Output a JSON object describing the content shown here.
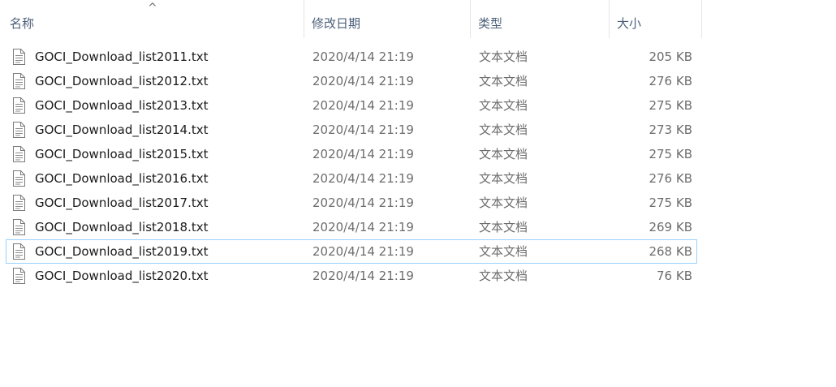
{
  "header": {
    "name": "名称",
    "date": "修改日期",
    "type": "类型",
    "size": "大小",
    "sort_indicator": "^"
  },
  "colors": {
    "header_text": "#4c607a",
    "selection_border": "#99d1ff"
  },
  "icon": "text-file-icon",
  "files": [
    {
      "name": "GOCI_Download_list2011.txt",
      "date": "2020/4/14 21:19",
      "type": "文本文档",
      "size": "205 KB"
    },
    {
      "name": "GOCI_Download_list2012.txt",
      "date": "2020/4/14 21:19",
      "type": "文本文档",
      "size": "276 KB"
    },
    {
      "name": "GOCI_Download_list2013.txt",
      "date": "2020/4/14 21:19",
      "type": "文本文档",
      "size": "275 KB"
    },
    {
      "name": "GOCI_Download_list2014.txt",
      "date": "2020/4/14 21:19",
      "type": "文本文档",
      "size": "273 KB"
    },
    {
      "name": "GOCI_Download_list2015.txt",
      "date": "2020/4/14 21:19",
      "type": "文本文档",
      "size": "275 KB"
    },
    {
      "name": "GOCI_Download_list2016.txt",
      "date": "2020/4/14 21:19",
      "type": "文本文档",
      "size": "276 KB"
    },
    {
      "name": "GOCI_Download_list2017.txt",
      "date": "2020/4/14 21:19",
      "type": "文本文档",
      "size": "275 KB"
    },
    {
      "name": "GOCI_Download_list2018.txt",
      "date": "2020/4/14 21:19",
      "type": "文本文档",
      "size": "269 KB"
    },
    {
      "name": "GOCI_Download_list2019.txt",
      "date": "2020/4/14 21:19",
      "type": "文本文档",
      "size": "268 KB"
    },
    {
      "name": "GOCI_Download_list2020.txt",
      "date": "2020/4/14 21:19",
      "type": "文本文档",
      "size": "76 KB"
    }
  ],
  "selected_index": 8
}
